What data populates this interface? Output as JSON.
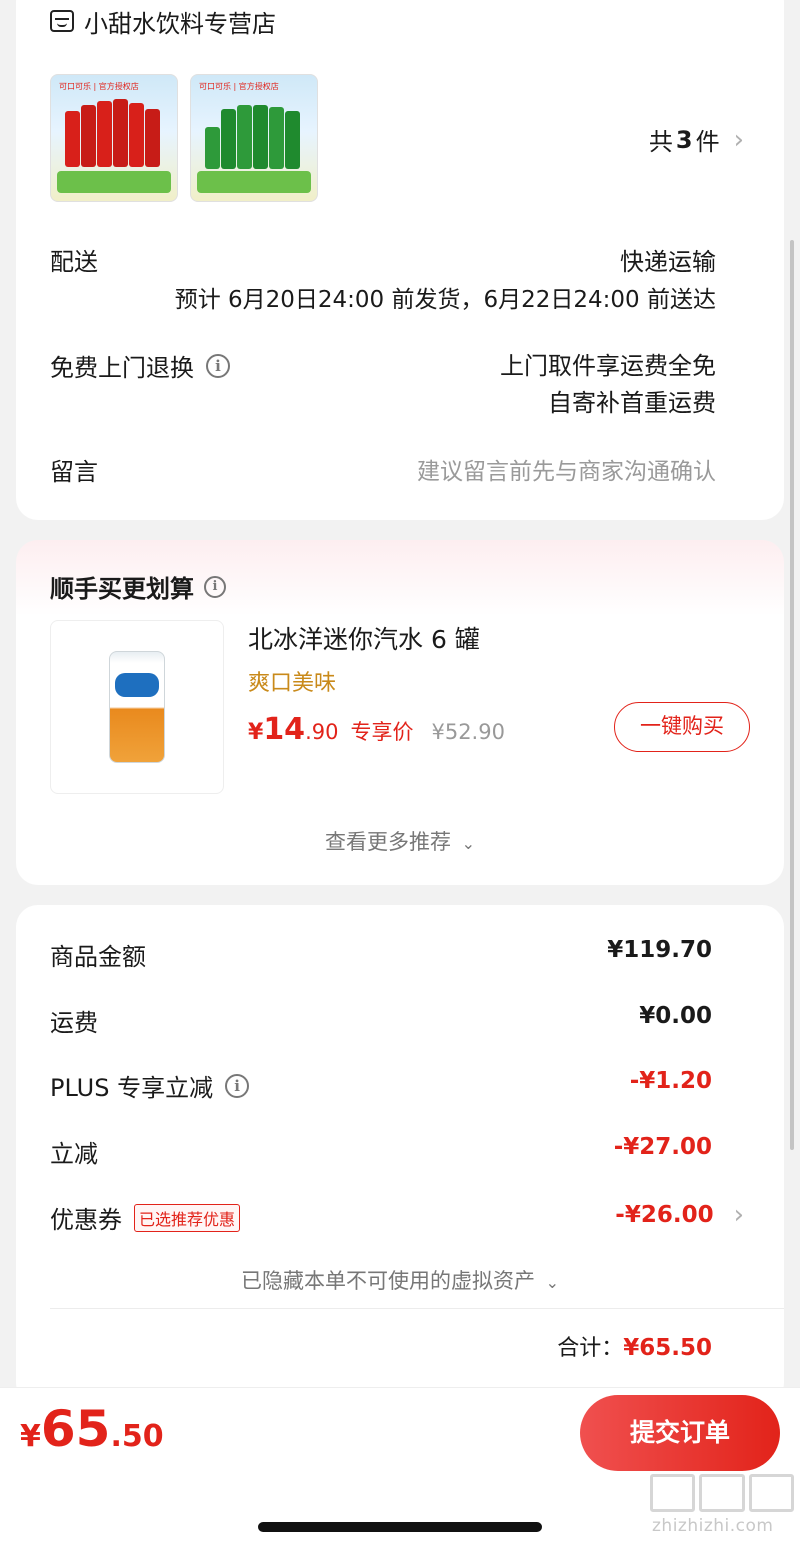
{
  "store": {
    "icon": "store-icon",
    "name": "小甜水饮料专营店"
  },
  "items": {
    "count_prefix": "共",
    "count": "3",
    "count_suffix": "件"
  },
  "delivery": {
    "label": "配送",
    "method": "快递运输",
    "estimate": "预计 6月20日24:00 前发货，6月22日24:00 前送达"
  },
  "return_service": {
    "label": "免费上门退换",
    "line1": "上门取件享运费全免",
    "line2": "自寄补首重运费"
  },
  "message": {
    "label": "留言",
    "placeholder": "建议留言前先与商家沟通确认"
  },
  "recommend": {
    "title": "顺手买更划算",
    "product_name": "北冰洋迷你汽水 6 罐",
    "tagline": "爽口美味",
    "price_symbol": "¥",
    "price_int": "14",
    "price_dec": ".90",
    "price_label": "专享价",
    "original_price": "¥52.90",
    "buy_button": "一键购买",
    "more": "查看更多推荐"
  },
  "summary": {
    "goods_label": "商品金额",
    "goods_value": "¥119.70",
    "shipping_label": "运费",
    "shipping_value": "¥0.00",
    "plus_label": "PLUS 专享立减",
    "plus_value": "-¥1.20",
    "discount_label": "立减",
    "discount_value": "-¥27.00",
    "coupon_label": "优惠券",
    "coupon_badge": "已选推荐优惠",
    "coupon_value": "-¥26.00",
    "hidden_assets": "已隐藏本单不可使用的虚拟资产",
    "total_label": "合计：",
    "total_value": "¥65.50"
  },
  "bottom": {
    "price_symbol": "¥",
    "price_int": "65",
    "price_dec": ".50",
    "submit": "提交订单"
  },
  "watermark": "zhizhizhi.com",
  "colors": {
    "accent": "#e2231a",
    "button_grad_start": "#f0504f",
    "button_grad_end": "#e2231a",
    "tagline": "#c98a1a"
  }
}
